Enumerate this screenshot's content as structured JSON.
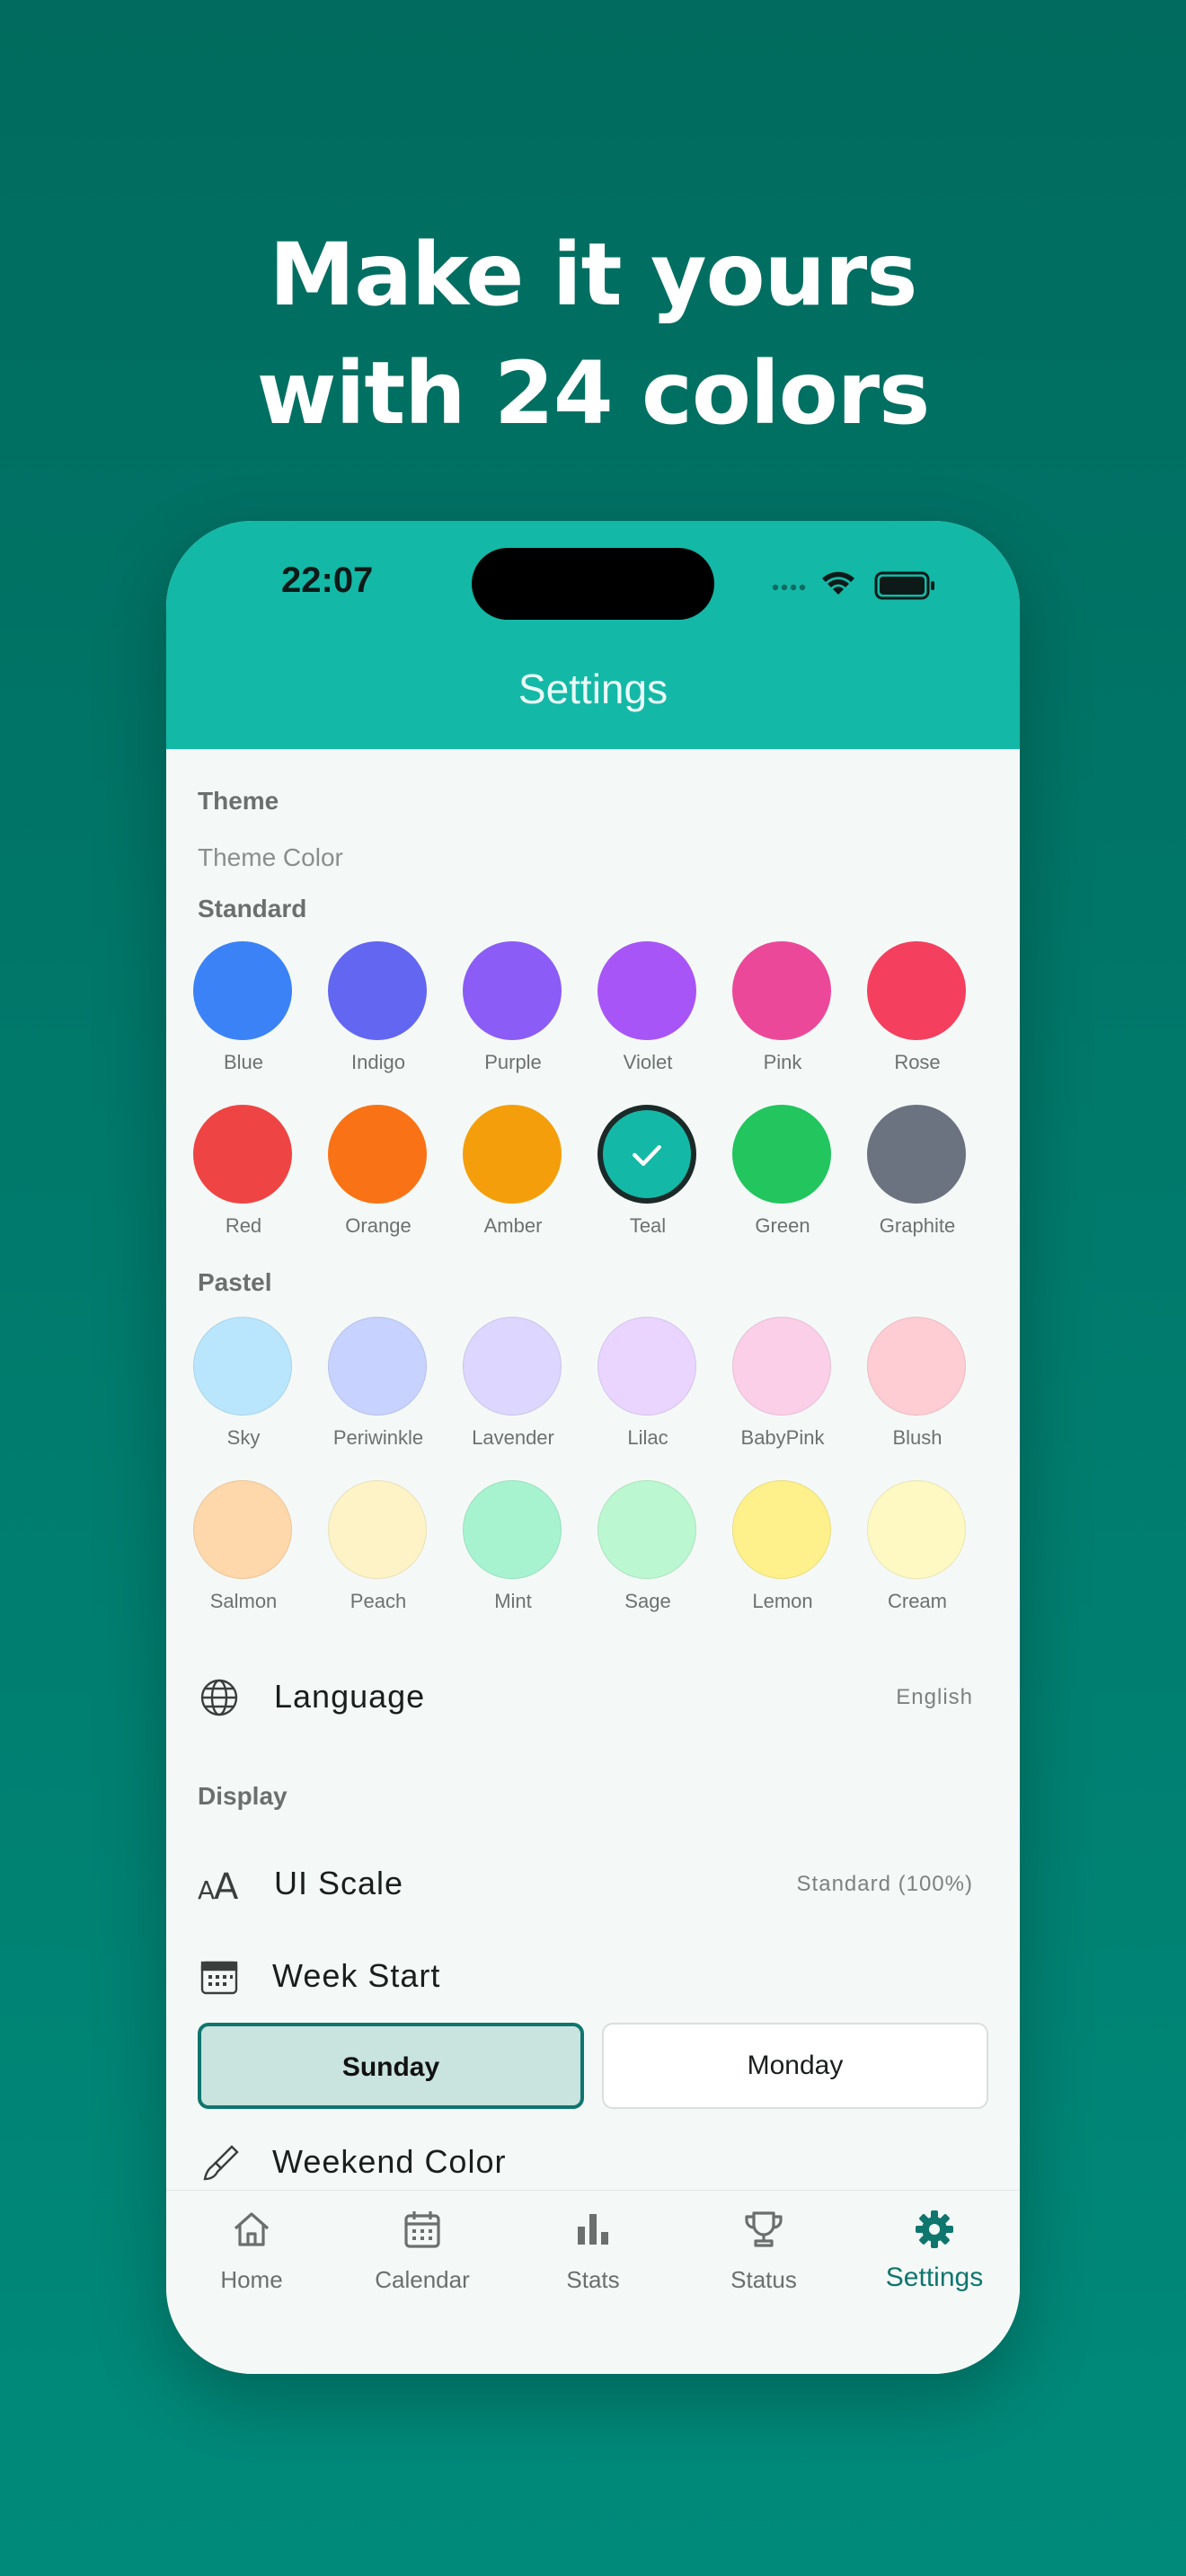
{
  "headline": {
    "line1": "Make it yours",
    "line2": "with 24 colors"
  },
  "status_bar": {
    "time": "22:07"
  },
  "header": {
    "title": "Settings"
  },
  "theme": {
    "section_title": "Theme",
    "color_label": "Theme Color",
    "standard_label": "Standard",
    "pastel_label": "Pastel",
    "selected": "Teal",
    "standard": [
      {
        "name": "Blue",
        "color": "#3b82f6"
      },
      {
        "name": "Indigo",
        "color": "#6366f1"
      },
      {
        "name": "Purple",
        "color": "#8b5cf6"
      },
      {
        "name": "Violet",
        "color": "#a855f7"
      },
      {
        "name": "Pink",
        "color": "#ec4899"
      },
      {
        "name": "Rose",
        "color": "#f43f5e"
      },
      {
        "name": "Red",
        "color": "#ef4444"
      },
      {
        "name": "Orange",
        "color": "#f97316"
      },
      {
        "name": "Amber",
        "color": "#f59e0b"
      },
      {
        "name": "Teal",
        "color": "#14b8a6"
      },
      {
        "name": "Green",
        "color": "#22c55e"
      },
      {
        "name": "Graphite",
        "color": "#6b7280"
      }
    ],
    "pastel": [
      {
        "name": "Sky",
        "color": "#bae6fd"
      },
      {
        "name": "Periwinkle",
        "color": "#c7d2fe"
      },
      {
        "name": "Lavender",
        "color": "#ddd6fe"
      },
      {
        "name": "Lilac",
        "color": "#e9d5ff"
      },
      {
        "name": "BabyPink",
        "color": "#fbcfe8"
      },
      {
        "name": "Blush",
        "color": "#fecdd3"
      },
      {
        "name": "Salmon",
        "color": "#fed7aa"
      },
      {
        "name": "Peach",
        "color": "#fef3c7"
      },
      {
        "name": "Mint",
        "color": "#a7f3d0"
      },
      {
        "name": "Sage",
        "color": "#bbf7d0"
      },
      {
        "name": "Lemon",
        "color": "#fef08a"
      },
      {
        "name": "Cream",
        "color": "#fef9c3"
      }
    ]
  },
  "language": {
    "label": "Language",
    "value": "English",
    "icon": "globe-icon"
  },
  "display": {
    "section_title": "Display",
    "ui_scale": {
      "label": "UI Scale",
      "value": "Standard (100%)",
      "icon": "text-size-icon"
    },
    "week_start": {
      "label": "Week Start",
      "icon": "calendar-grid-icon",
      "options": [
        "Sunday",
        "Monday"
      ],
      "selected": "Sunday"
    },
    "weekend_color": {
      "label": "Weekend Color",
      "icon": "paintbrush-icon"
    }
  },
  "tabs": [
    {
      "label": "Home",
      "icon": "home-icon"
    },
    {
      "label": "Calendar",
      "icon": "calendar-icon"
    },
    {
      "label": "Stats",
      "icon": "bar-chart-icon"
    },
    {
      "label": "Status",
      "icon": "trophy-icon"
    },
    {
      "label": "Settings",
      "icon": "gear-icon",
      "active": true
    }
  ],
  "colors": {
    "accent": "#14b8a6",
    "accent_dark": "#0f766e",
    "selected_segment": "#c9e3de"
  }
}
